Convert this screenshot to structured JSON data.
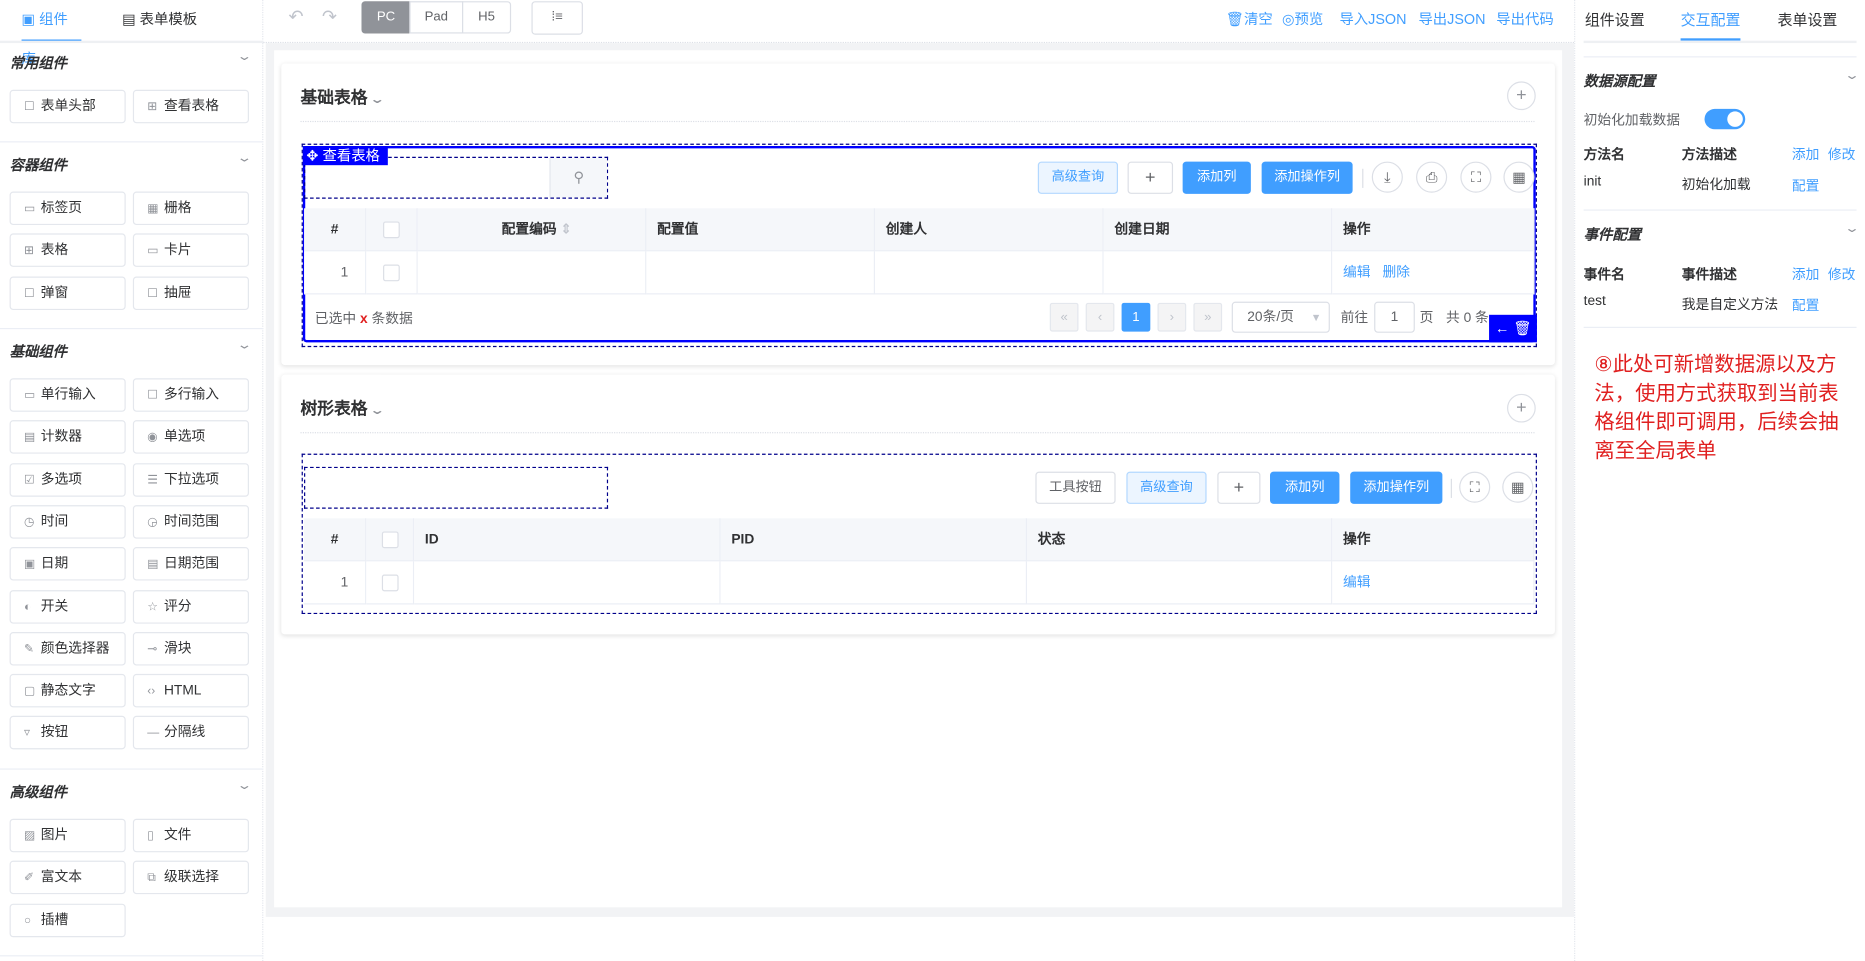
{
  "left_tabs": [
    {
      "label": "组件库",
      "icon": "component-icon",
      "active": true
    },
    {
      "label": "表单模板",
      "icon": "template-icon",
      "active": false
    }
  ],
  "sections": [
    {
      "title": "常用组件",
      "items": [
        {
          "label": "表单头部",
          "icon": "square-icon"
        },
        {
          "label": "查看表格",
          "icon": "table-icon"
        }
      ]
    },
    {
      "title": "容器组件",
      "items": [
        {
          "label": "标签页",
          "icon": "folder-icon"
        },
        {
          "label": "栅格",
          "icon": "grid-icon"
        },
        {
          "label": "表格",
          "icon": "table-icon"
        },
        {
          "label": "卡片",
          "icon": "card-icon"
        },
        {
          "label": "弹窗",
          "icon": "square-icon"
        },
        {
          "label": "抽屉",
          "icon": "square-icon"
        }
      ]
    },
    {
      "title": "基础组件",
      "items": [
        {
          "label": "单行输入",
          "icon": "input-icon"
        },
        {
          "label": "多行输入",
          "icon": "textarea-icon"
        },
        {
          "label": "计数器",
          "icon": "number-icon"
        },
        {
          "label": "单选项",
          "icon": "radio-icon"
        },
        {
          "label": "多选项",
          "icon": "checkbox-icon"
        },
        {
          "label": "下拉选项",
          "icon": "list-icon"
        },
        {
          "label": "时间",
          "icon": "clock-icon"
        },
        {
          "label": "时间范围",
          "icon": "time-range-icon"
        },
        {
          "label": "日期",
          "icon": "calendar-icon"
        },
        {
          "label": "日期范围",
          "icon": "date-range-icon"
        },
        {
          "label": "开关",
          "icon": "switch-icon"
        },
        {
          "label": "评分",
          "icon": "star-icon"
        },
        {
          "label": "颜色选择器",
          "icon": "pen-icon"
        },
        {
          "label": "滑块",
          "icon": "slider-icon"
        },
        {
          "label": "静态文字",
          "icon": "text-icon"
        },
        {
          "label": "HTML",
          "icon": "code-icon"
        },
        {
          "label": "按钮",
          "icon": "button-icon"
        },
        {
          "label": "分隔线",
          "icon": "divider-icon"
        }
      ]
    },
    {
      "title": "高级组件",
      "items": [
        {
          "label": "图片",
          "icon": "image-icon"
        },
        {
          "label": "文件",
          "icon": "file-icon"
        },
        {
          "label": "富文本",
          "icon": "edit-icon"
        },
        {
          "label": "级联选择",
          "icon": "cascader-icon"
        },
        {
          "label": "插槽",
          "icon": "slot-icon"
        }
      ]
    }
  ],
  "toolbar": {
    "devices": [
      "PC",
      "Pad",
      "H5"
    ],
    "active_device": "PC",
    "actions": [
      {
        "label": "清空",
        "icon": "trash-icon"
      },
      {
        "label": "预览",
        "icon": "eye-icon"
      },
      {
        "label": "导入JSON"
      },
      {
        "label": "导出JSON"
      },
      {
        "label": "导出代码"
      }
    ]
  },
  "card1": {
    "title": "基础表格",
    "tag": "查看表格",
    "buttons": [
      "高级查询",
      "+",
      "添加列",
      "添加操作列"
    ],
    "columns": [
      "#",
      "",
      "配置编码",
      "配置值",
      "创建人",
      "创建日期",
      "操作"
    ],
    "row": {
      "index": "1",
      "actions": [
        "编辑",
        "删除"
      ]
    },
    "footer": {
      "selected_prefix": "已选中",
      "selected_x": "x",
      "selected_suffix": "条数据",
      "current_page": "1",
      "page_size": "20条/页",
      "goto": "前往",
      "goto_value": "1",
      "page_unit": "页",
      "total": "共 0 条"
    }
  },
  "card2": {
    "title": "树形表格",
    "buttons": [
      "工具按钮",
      "高级查询",
      "+",
      "添加列",
      "添加操作列"
    ],
    "columns": [
      "#",
      "",
      "ID",
      "PID",
      "状态",
      "操作"
    ],
    "row": {
      "index": "1",
      "actions": [
        "编辑"
      ]
    }
  },
  "right": {
    "tabs": [
      "组件设置",
      "交互配置",
      "表单设置"
    ],
    "active_tab": "交互配置",
    "datasource": {
      "title": "数据源配置",
      "init_label": "初始化加载数据",
      "init_on": true,
      "col_name": "方法名",
      "col_desc": "方法描述",
      "add": "添加",
      "edit": "修改",
      "rows": [
        {
          "name": "init",
          "desc": "初始化加载",
          "action": "配置"
        }
      ]
    },
    "events": {
      "title": "事件配置",
      "col_name": "事件名",
      "col_desc": "事件描述",
      "add": "添加",
      "edit": "修改",
      "rows": [
        {
          "name": "test",
          "desc": "我是自定义方法",
          "action": "配置"
        }
      ]
    },
    "note": "⑧此处可新增数据源以及方法，使用方式获取到当前表格组件即可调用，后续会抽离至全局表单"
  },
  "colors": {
    "primary": "#409eff",
    "selection": "#0000ff",
    "note": "#e02020"
  }
}
